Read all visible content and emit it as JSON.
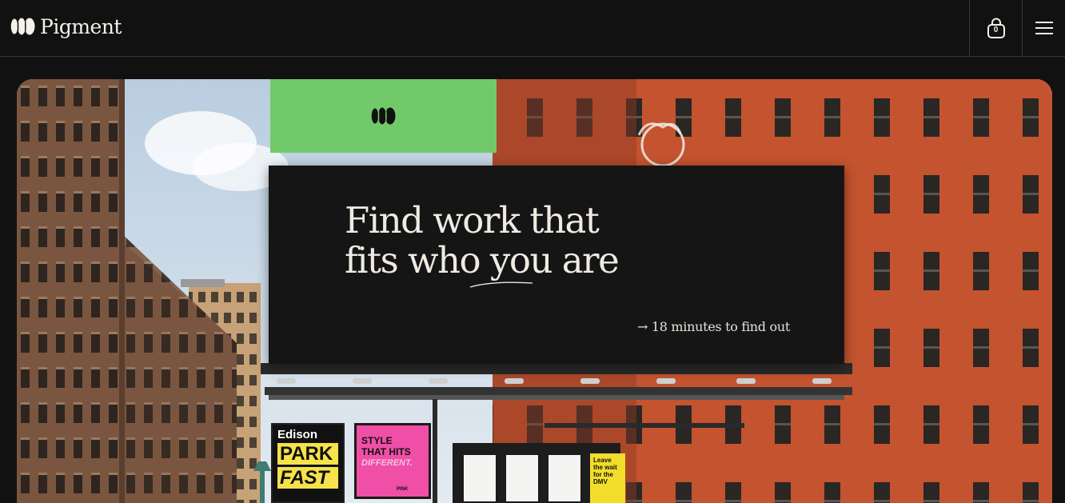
{
  "header": {
    "brand_name": "Pigment",
    "cart_count": "0",
    "icons": {
      "logo": "pigment-logo-icon",
      "cart": "shopping-bag-icon",
      "menu": "hamburger-menu-icon"
    }
  },
  "hero": {
    "headline_line1": "Find work that",
    "headline_line2": "fits who you are",
    "cta_label": "→ 18 minutes to find out",
    "posters": {
      "edison_title": "Edison",
      "edison_line2": "PARK",
      "edison_line3": "FAST",
      "style_line1": "STYLE",
      "style_line2": "THAT HITS",
      "style_line3": "DIFFERENT.",
      "style_brand": "PINK",
      "dmv_text": "Leave the wait for the DMV"
    }
  },
  "colors": {
    "background": "#111111",
    "billboard": "#151515",
    "accent_green": "#72c96a",
    "brick": "#c85438",
    "text_light": "#efebe3"
  }
}
